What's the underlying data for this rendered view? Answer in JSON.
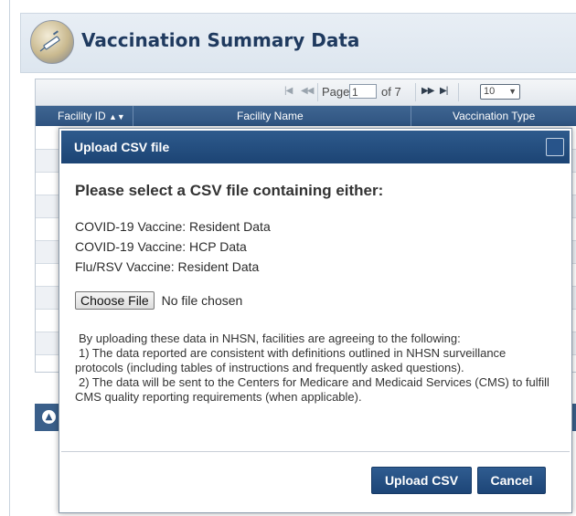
{
  "page": {
    "title": "Vaccination Summary Data"
  },
  "grid": {
    "pager": {
      "page_label": "Page",
      "current_page": "1",
      "of_label": "of 7",
      "page_size": "10"
    },
    "columns": [
      "Facility ID",
      "Facility Name",
      "Vaccination Type"
    ],
    "sort_icon": "sort-arrows-icon"
  },
  "modal": {
    "title": "Upload CSV file",
    "heading": "Please select a CSV file containing either:",
    "file_types": [
      "COVID-19 Vaccine: Resident Data",
      "COVID-19 Vaccine: HCP Data",
      "Flu/RSV Vaccine: Resident Data"
    ],
    "choose_file_label": "Choose File",
    "no_file_text": "No file chosen",
    "disclaimer": {
      "intro": "By uploading these data in NHSN, facilities are agreeing to the following:",
      "point1": "1) The data reported are consistent with definitions outlined in NHSN surveillance protocols (including tables of instructions and frequently asked questions).",
      "point2": "2) The data will be sent to the Centers for Medicare and Medicaid Services (CMS) to fulfill CMS quality reporting requirements (when applicable)."
    },
    "upload_button": "Upload CSV",
    "cancel_button": "Cancel"
  },
  "colors": {
    "header_blue": "#2f5380",
    "modal_title_blue": "#1c4474",
    "title_text": "#1f3a5f"
  }
}
